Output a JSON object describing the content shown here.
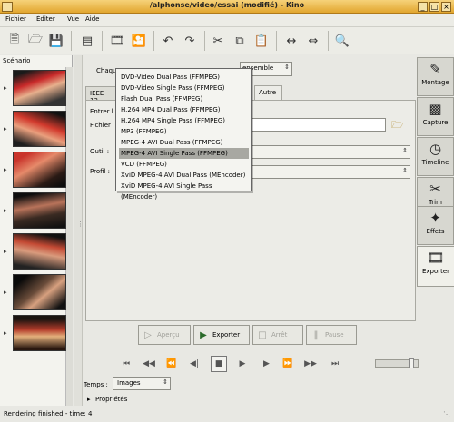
{
  "window": {
    "title": "/alphonse/video/essai (modifié)  - Kino",
    "controls": [
      "_",
      "□",
      "×"
    ]
  },
  "menubar": [
    "Fichier",
    "Éditer",
    "Vue",
    "Aide"
  ],
  "scenario": {
    "label": "Scénario",
    "thumb_count": 7
  },
  "side_tabs": [
    {
      "label": "Montage",
      "icon": "film-edit-icon"
    },
    {
      "label": "Capture",
      "icon": "camera-icon"
    },
    {
      "label": "Timeline",
      "icon": "clock-icon"
    },
    {
      "label": "Trim",
      "icon": "scissors-film-icon"
    },
    {
      "label": "Effets",
      "icon": "sparkle-icon"
    },
    {
      "label": "Exporter",
      "icon": "export-film-icon"
    }
  ],
  "export": {
    "chaque_label": "Chaque",
    "scope_value": "ensemble",
    "tabs": [
      "IEEE 13",
      "Autre"
    ],
    "entrer_label": "Entrer l",
    "fichier_label": "Fichier",
    "outil_label": "Outil :",
    "profil_label": "Profil :"
  },
  "tool_menu": {
    "items": [
      "DVD-Video Dual Pass (FFMPEG)",
      "DVD-Video Single Pass (FFMPEG)",
      "Flash Dual Pass (FFMPEG)",
      "H.264 MP4 Dual Pass (FFMPEG)",
      "H.264 MP4 Single Pass (FFMPEG)",
      "MP3 (FFMPEG)",
      "MPEG-4 AVI Dual Pass (FFMPEG)",
      "MPEG-4 AVI Single Pass (FFMPEG)",
      "VCD (FFMPEG)",
      "XviD MPEG-4 AVI Dual Pass (MEncoder)",
      "XviD MPEG-4 AVI Single Pass (MEncoder)"
    ],
    "selected": "MPEG-4 AVI Single Pass (FFMPEG)"
  },
  "action_buttons": {
    "apercu": "Aperçu",
    "exporter": "Exporter",
    "arret": "Arrêt",
    "pause": "Pause"
  },
  "time": {
    "label": "Temps :",
    "unit": "Images"
  },
  "properties_label": "Propriétés",
  "status": "Rendering finished - time: 4"
}
